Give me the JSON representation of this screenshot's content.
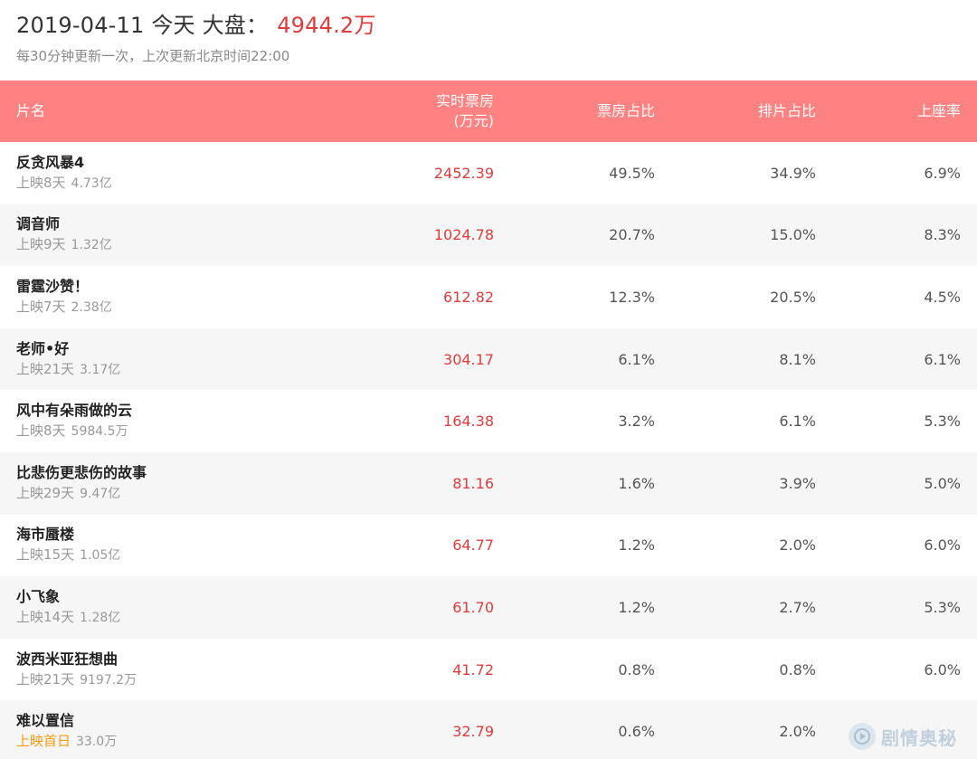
{
  "header": {
    "date": "2019-04-11",
    "day_label": "今天",
    "market_label": "大盘：",
    "total": "4944.2万",
    "update_note": "每30分钟更新一次，上次更新北京时间22:00"
  },
  "columns": {
    "name": "片名",
    "box_line1": "实时票房",
    "box_line2": "(万元)",
    "box_share": "票房占比",
    "screening_share": "排片占比",
    "occupancy": "上座率"
  },
  "rows": [
    {
      "title": "反贪风暴4",
      "status": "上映8天",
      "gross": "4.73亿",
      "box": "2452.39",
      "box_share": "49.5%",
      "screening_share": "34.9%",
      "occupancy": "6.9%"
    },
    {
      "title": "调音师",
      "status": "上映9天",
      "gross": "1.32亿",
      "box": "1024.78",
      "box_share": "20.7%",
      "screening_share": "15.0%",
      "occupancy": "8.3%"
    },
    {
      "title": "雷霆沙赞！",
      "status": "上映7天",
      "gross": "2.38亿",
      "box": "612.82",
      "box_share": "12.3%",
      "screening_share": "20.5%",
      "occupancy": "4.5%"
    },
    {
      "title": "老师•好",
      "status": "上映21天",
      "gross": "3.17亿",
      "box": "304.17",
      "box_share": "6.1%",
      "screening_share": "8.1%",
      "occupancy": "6.1%"
    },
    {
      "title": "风中有朵雨做的云",
      "status": "上映8天",
      "gross": "5984.5万",
      "box": "164.38",
      "box_share": "3.2%",
      "screening_share": "6.1%",
      "occupancy": "5.3%"
    },
    {
      "title": "比悲伤更悲伤的故事",
      "status": "上映29天",
      "gross": "9.47亿",
      "box": "81.16",
      "box_share": "1.6%",
      "screening_share": "3.9%",
      "occupancy": "5.0%"
    },
    {
      "title": "海市蜃楼",
      "status": "上映15天",
      "gross": "1.05亿",
      "box": "64.77",
      "box_share": "1.2%",
      "screening_share": "2.0%",
      "occupancy": "6.0%"
    },
    {
      "title": "小飞象",
      "status": "上映14天",
      "gross": "1.28亿",
      "box": "61.70",
      "box_share": "1.2%",
      "screening_share": "2.7%",
      "occupancy": "5.3%"
    },
    {
      "title": "波西米亚狂想曲",
      "status": "上映21天",
      "gross": "9197.2万",
      "box": "41.72",
      "box_share": "0.8%",
      "screening_share": "0.8%",
      "occupancy": "6.0%"
    },
    {
      "title": "难以置信",
      "status": "上映首日",
      "gross": "33.0万",
      "box": "32.79",
      "box_share": "0.6%",
      "screening_share": "2.0%",
      "occupancy": "",
      "first_day": true
    }
  ],
  "watermark": {
    "text": "剧情奥秘",
    "icon": "play-circle-icon"
  },
  "colors": {
    "header_bg": "#fe8281",
    "accent_red": "#e03c3c",
    "first_day_orange": "#f39c12",
    "stripe": "#f6f6f6"
  }
}
